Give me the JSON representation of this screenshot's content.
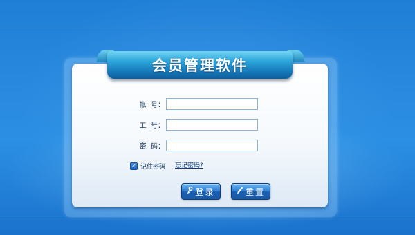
{
  "app": {
    "title": "会员管理软件"
  },
  "form": {
    "account_label": "帐  号：",
    "account_value": "",
    "employee_id_label": "工  号：",
    "employee_id_value": "",
    "password_label": "密  码：",
    "password_value": ""
  },
  "remember": {
    "label": "记住密码",
    "checked": true
  },
  "forgot_password": {
    "label": "忘记密码?"
  },
  "buttons": {
    "login_label": "登录",
    "reset_label": "重置"
  },
  "icons": {
    "login": "key-icon",
    "reset": "pencil-icon",
    "checkbox": "checkmark-icon"
  },
  "colors": {
    "background": "#2a8be0",
    "ribbon": "#1577b8",
    "button": "#2f7fd2",
    "panel": "#ffffff"
  }
}
